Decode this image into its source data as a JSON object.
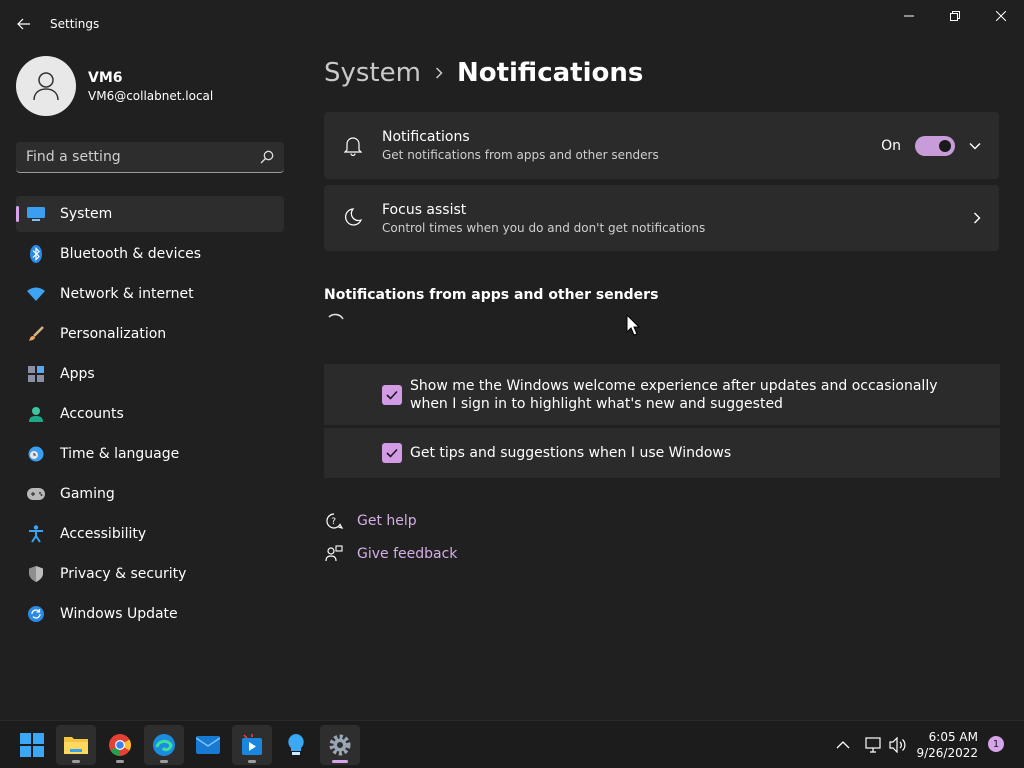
{
  "window": {
    "title": "Settings"
  },
  "profile": {
    "name": "VM6",
    "email": "VM6@collabnet.local"
  },
  "search": {
    "placeholder": "Find a setting"
  },
  "nav": {
    "items": [
      {
        "label": "System",
        "active": true
      },
      {
        "label": "Bluetooth & devices"
      },
      {
        "label": "Network & internet"
      },
      {
        "label": "Personalization"
      },
      {
        "label": "Apps"
      },
      {
        "label": "Accounts"
      },
      {
        "label": "Time & language"
      },
      {
        "label": "Gaming"
      },
      {
        "label": "Accessibility"
      },
      {
        "label": "Privacy & security"
      },
      {
        "label": "Windows Update"
      }
    ]
  },
  "breadcrumb": {
    "parent": "System",
    "current": "Notifications"
  },
  "notifications": {
    "title": "Notifications",
    "subtitle": "Get notifications from apps and other senders",
    "state": "On",
    "toggle_on": true
  },
  "focus_assist": {
    "title": "Focus assist",
    "subtitle": "Control times when you do and don't get notifications"
  },
  "section": {
    "heading": "Notifications from apps and other senders"
  },
  "checks": [
    {
      "label": "Show me the Windows welcome experience after updates and occasionally when I sign in to highlight what's new and suggested",
      "checked": true
    },
    {
      "label": "Get tips and suggestions when I use Windows",
      "checked": true
    }
  ],
  "links": {
    "help": "Get help",
    "feedback": "Give feedback"
  },
  "taskbar": {
    "time": "6:05 AM",
    "date": "9/26/2022",
    "notification_count": "1"
  },
  "colors": {
    "accent": "#d6a4e8",
    "background": "#202020",
    "card": "#2b2b2b"
  }
}
